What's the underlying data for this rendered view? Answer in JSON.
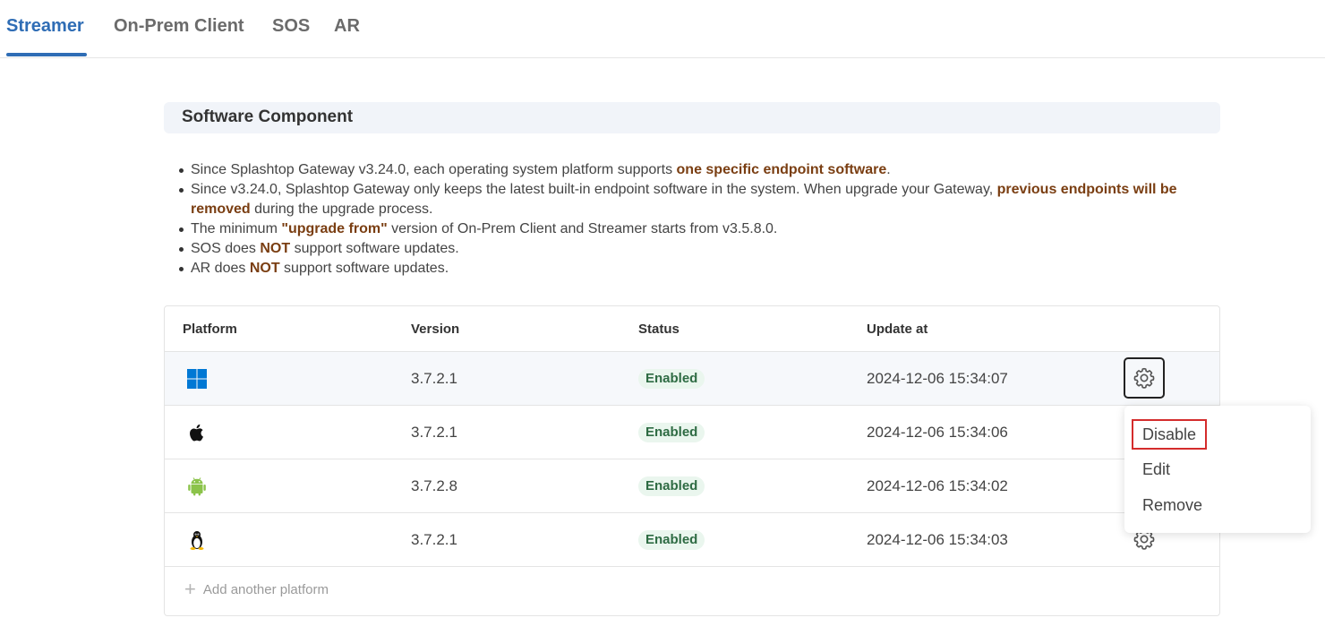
{
  "tabs": [
    {
      "label": "Streamer",
      "active": true
    },
    {
      "label": "On-Prem Client",
      "active": false
    },
    {
      "label": "SOS",
      "active": false
    },
    {
      "label": "AR",
      "active": false
    }
  ],
  "section": {
    "title": "Software Component"
  },
  "notes": [
    {
      "before": "Since Splashtop Gateway v3.24.0, each operating system platform supports ",
      "highlight": "one specific endpoint software",
      "after": "."
    },
    {
      "before": "Since v3.24.0, Splashtop Gateway only keeps the latest built-in endpoint software in the system. When upgrade your Gateway, ",
      "highlight": "previous endpoints will be removed",
      "after": " during the upgrade process."
    },
    {
      "before": "The minimum ",
      "highlight": "\"upgrade from\"",
      "after": " version of On-Prem Client and Streamer starts from v3.5.8.0."
    },
    {
      "before": "SOS does ",
      "highlight": "NOT",
      "after": " support software updates."
    },
    {
      "before": "AR does ",
      "highlight": "NOT",
      "after": " support software updates."
    }
  ],
  "table": {
    "headers": {
      "platform": "Platform",
      "version": "Version",
      "status": "Status",
      "update_at": "Update at"
    },
    "rows": [
      {
        "platform": "windows-icon",
        "version": "3.7.2.1",
        "status": "Enabled",
        "update_at": "2024-12-06 15:34:07"
      },
      {
        "platform": "apple-icon",
        "version": "3.7.2.1",
        "status": "Enabled",
        "update_at": "2024-12-06 15:34:06"
      },
      {
        "platform": "android-icon",
        "version": "3.7.2.8",
        "status": "Enabled",
        "update_at": "2024-12-06 15:34:02"
      },
      {
        "platform": "linux-icon",
        "version": "3.7.2.1",
        "status": "Enabled",
        "update_at": "2024-12-06 15:34:03"
      }
    ],
    "add_label": "Add another platform"
  },
  "menu": {
    "items": [
      "Disable",
      "Edit",
      "Remove"
    ]
  },
  "colors": {
    "accent": "#2f6db5",
    "highlight": "#7a3e12",
    "badge_bg": "#eaf6ee",
    "badge_text": "#2e6b43",
    "windows": "#0078d4",
    "android": "#8bc34a",
    "menu_outline": "#d42c2c"
  }
}
